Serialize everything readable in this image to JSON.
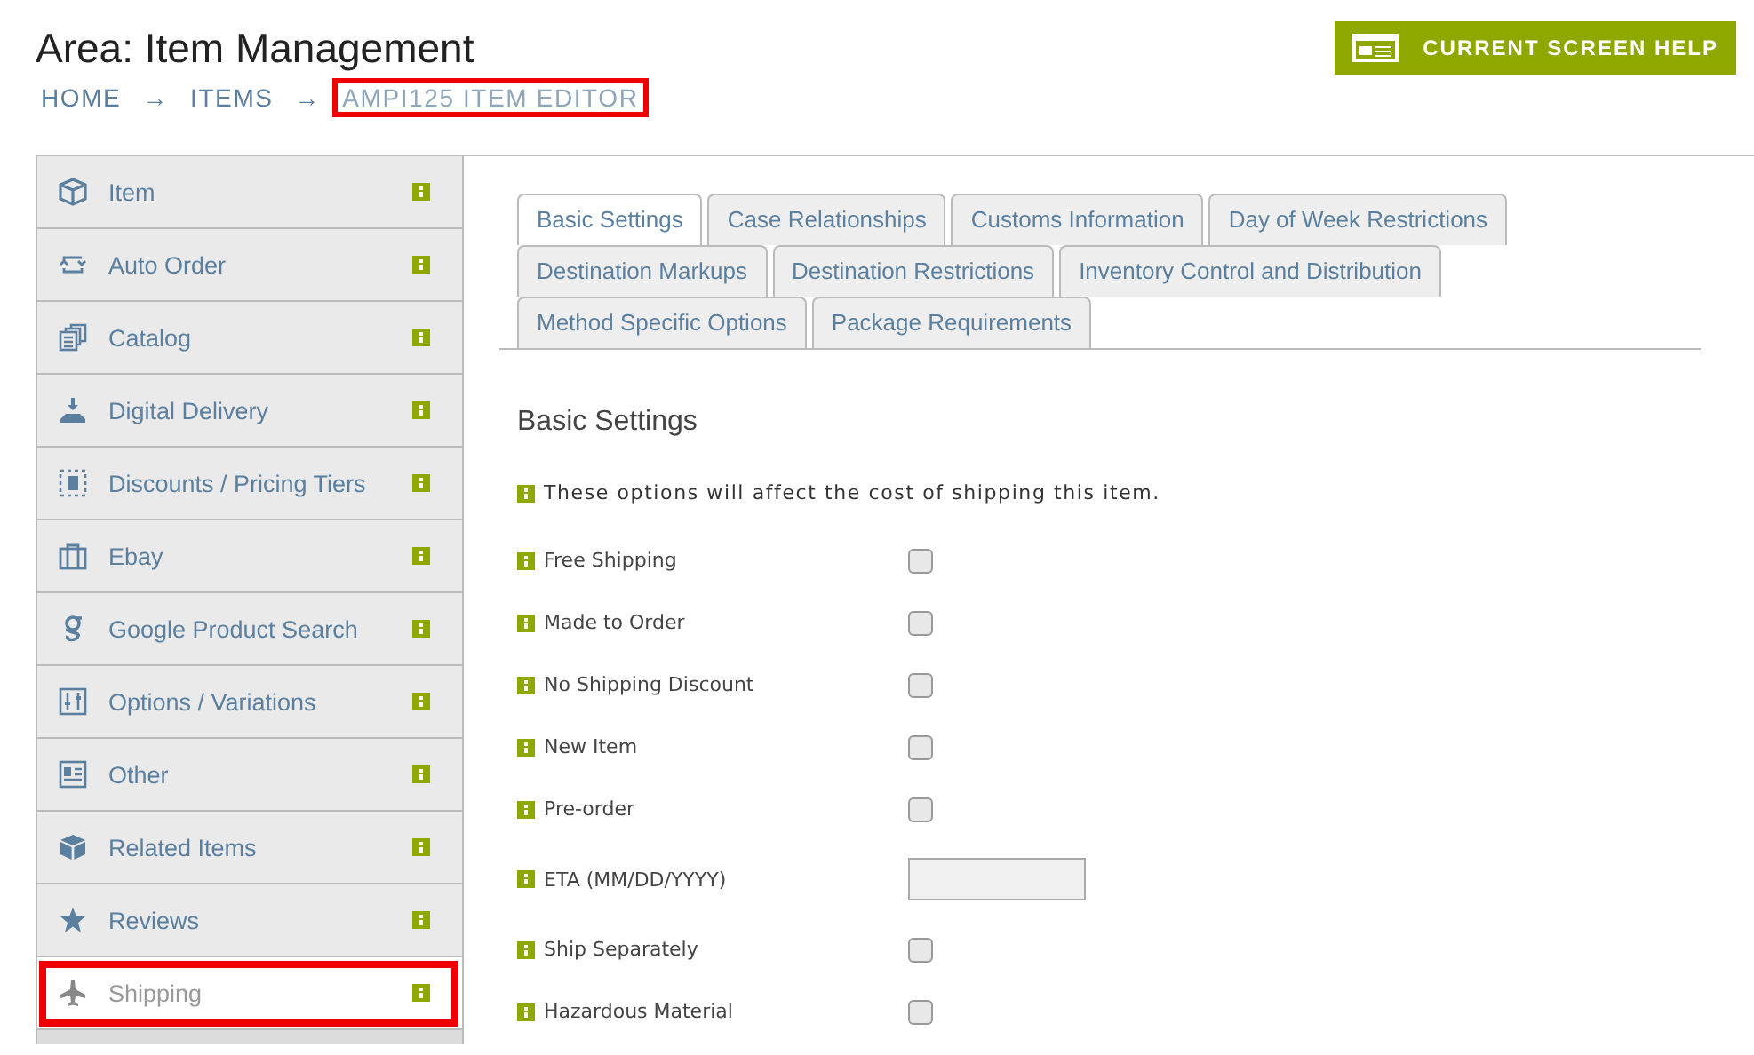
{
  "header": {
    "title": "Area: Item Management",
    "help_button": "CURRENT SCREEN HELP"
  },
  "breadcrumb": [
    {
      "label": "HOME",
      "highlighted": false
    },
    {
      "label": "→",
      "highlighted": false
    },
    {
      "label": "ITEMS",
      "highlighted": false
    },
    {
      "label": "→",
      "highlighted": false
    },
    {
      "label": "AMPI125 ITEM EDITOR",
      "highlighted": true
    }
  ],
  "sidebar": {
    "items": [
      {
        "label": "Item",
        "selected": false,
        "highlighted": false
      },
      {
        "label": "Auto Order",
        "selected": false,
        "highlighted": false
      },
      {
        "label": "Catalog",
        "selected": false,
        "highlighted": false
      },
      {
        "label": "Digital Delivery",
        "selected": false,
        "highlighted": false
      },
      {
        "label": "Discounts / Pricing Tiers",
        "selected": false,
        "highlighted": false
      },
      {
        "label": "Ebay",
        "selected": false,
        "highlighted": false
      },
      {
        "label": "Google Product Search",
        "selected": false,
        "highlighted": false
      },
      {
        "label": "Options / Variations",
        "selected": false,
        "highlighted": false
      },
      {
        "label": "Other",
        "selected": false,
        "highlighted": false
      },
      {
        "label": "Related Items",
        "selected": false,
        "highlighted": false
      },
      {
        "label": "Reviews",
        "selected": false,
        "highlighted": false
      },
      {
        "label": "Shipping",
        "selected": true,
        "highlighted": true
      }
    ]
  },
  "tabs": [
    {
      "label": "Basic Settings",
      "selected": true
    },
    {
      "label": "Case Relationships",
      "selected": false
    },
    {
      "label": "Customs Information",
      "selected": false
    },
    {
      "label": "Day of Week Restrictions",
      "selected": false
    },
    {
      "label": "Destination Markups",
      "selected": false
    },
    {
      "label": "Destination Restrictions",
      "selected": false
    },
    {
      "label": "Inventory Control and Distribution",
      "selected": false
    },
    {
      "label": "Method Specific Options",
      "selected": false
    },
    {
      "label": "Package Requirements",
      "selected": false
    }
  ],
  "section": {
    "title": "Basic Settings",
    "note": "These options will affect the cost of shipping this item.",
    "fields": [
      {
        "kind": "checkbox",
        "label": "Free Shipping",
        "checked": false
      },
      {
        "kind": "checkbox",
        "label": "Made to Order",
        "checked": false
      },
      {
        "kind": "checkbox",
        "label": "No Shipping Discount",
        "checked": false
      },
      {
        "kind": "checkbox",
        "label": "New Item",
        "checked": false
      },
      {
        "kind": "checkbox",
        "label": "Pre-order",
        "checked": false
      },
      {
        "kind": "text",
        "label": "ETA (MM/DD/YYYY)"
      },
      {
        "kind": "checkbox",
        "label": "Ship Separately",
        "checked": false
      },
      {
        "kind": "checkbox",
        "label": "Hazardous Material",
        "checked": false
      }
    ]
  }
}
